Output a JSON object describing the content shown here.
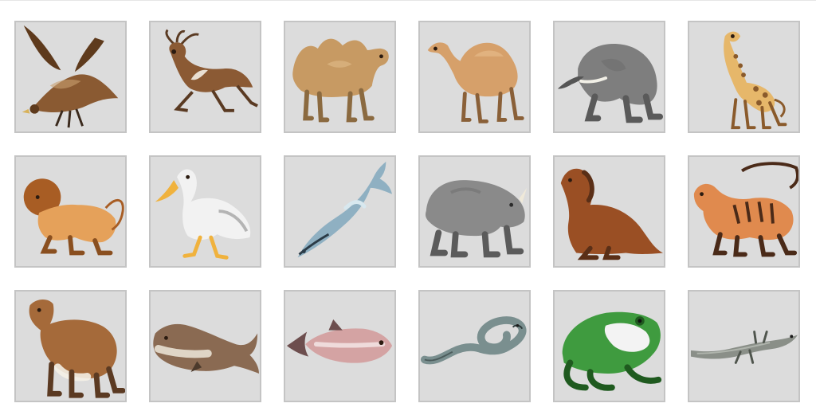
{
  "tiles": [
    {
      "id": "eagle",
      "icon": "eagle-icon",
      "colors": {
        "body": "#8a5a32",
        "dark": "#5e3a1c",
        "accent": "#c9a070"
      }
    },
    {
      "id": "deer",
      "icon": "deer-icon",
      "colors": {
        "body": "#8b5a34",
        "dark": "#5a3a22",
        "accent": "#e9dfd2"
      }
    },
    {
      "id": "bactrian-camel",
      "icon": "bactrian-camel-icon",
      "colors": {
        "body": "#c79a63",
        "dark": "#8b6a40",
        "accent": "#e2c08e"
      }
    },
    {
      "id": "dromedary-camel",
      "icon": "dromedary-camel-icon",
      "colors": {
        "body": "#d6a06a",
        "dark": "#8a6038",
        "accent": "#f0c79a"
      }
    },
    {
      "id": "elephant",
      "icon": "elephant-icon",
      "colors": {
        "body": "#7e7e7e",
        "dark": "#555555",
        "accent": "#f1efe6"
      }
    },
    {
      "id": "giraffe",
      "icon": "giraffe-icon",
      "colors": {
        "body": "#e6b76a",
        "dark": "#8a5a2b",
        "accent": "#f3e2c1"
      }
    },
    {
      "id": "lion",
      "icon": "lion-icon",
      "colors": {
        "body": "#e5a15a",
        "dark": "#8a4f1f",
        "accent": "#a85d24"
      }
    },
    {
      "id": "pelican",
      "icon": "pelican-icon",
      "colors": {
        "body": "#f2f2f2",
        "dark": "#8a8a8a",
        "accent": "#f0b23d"
      }
    },
    {
      "id": "dolphin",
      "icon": "dolphin-icon",
      "colors": {
        "body": "#8fb0c2",
        "dark": "#2b3b47",
        "accent": "#d8e8ef"
      }
    },
    {
      "id": "rhinoceros",
      "icon": "rhinoceros-icon",
      "colors": {
        "body": "#8a8a8a",
        "dark": "#5b5b5b",
        "accent": "#efe9d9"
      }
    },
    {
      "id": "dog",
      "icon": "dog-icon",
      "colors": {
        "body": "#9a4f24",
        "dark": "#5a2f17",
        "accent": "#b76b3a"
      }
    },
    {
      "id": "tiger",
      "icon": "tiger-icon",
      "colors": {
        "body": "#e08a4e",
        "dark": "#4a2a18",
        "accent": "#f3e2c7"
      }
    },
    {
      "id": "cow",
      "icon": "cow-icon",
      "colors": {
        "body": "#a56a3a",
        "dark": "#5b3a22",
        "accent": "#f4efe6"
      }
    },
    {
      "id": "whale",
      "icon": "whale-icon",
      "colors": {
        "body": "#8a6a52",
        "dark": "#4c3a2c",
        "accent": "#e8e1d3"
      }
    },
    {
      "id": "fish",
      "icon": "fish-icon",
      "colors": {
        "body": "#d4a3a3",
        "dark": "#6d4e4e",
        "accent": "#f3e5e5"
      }
    },
    {
      "id": "snake",
      "icon": "snake-icon",
      "colors": {
        "body": "#7a8f8f",
        "dark": "#2d3a3a",
        "accent": "#cfd9d9"
      }
    },
    {
      "id": "frog",
      "icon": "frog-icon",
      "colors": {
        "body": "#3f9b3f",
        "dark": "#1f5a1f",
        "accent": "#f3f3f3"
      }
    },
    {
      "id": "lizard",
      "icon": "lizard-icon",
      "colors": {
        "body": "#8a8f88",
        "dark": "#4f554d",
        "accent": "#b8bdb5"
      }
    }
  ]
}
